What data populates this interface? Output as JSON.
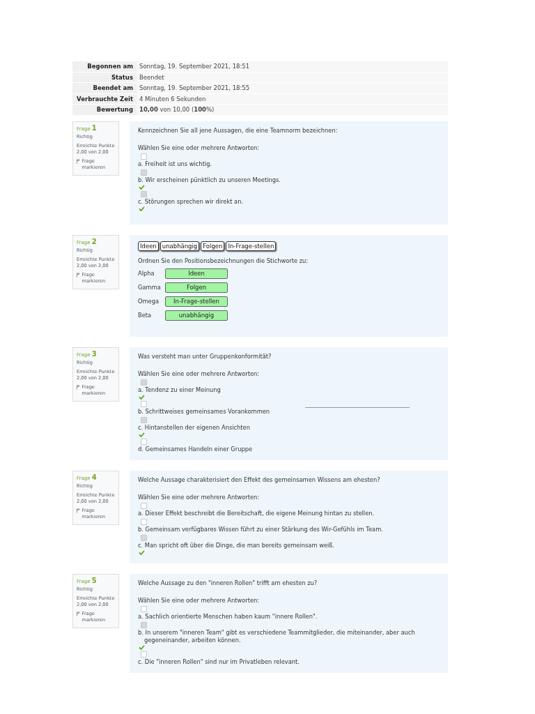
{
  "summary": [
    {
      "label": "Begonnen am",
      "value": "Sonntag, 19. September 2021, 18:51"
    },
    {
      "label": "Status",
      "value": "Beendet"
    },
    {
      "label": "Beendet am",
      "value": "Sonntag, 19. September 2021, 18:55"
    },
    {
      "label": "Verbrauchte Zeit",
      "value": "4 Minuten 6 Sekunden"
    },
    {
      "label": "Bewertung",
      "value": "**10,00** von 10,00 (**100**%)"
    }
  ],
  "questions": [
    {
      "kind": "multiple",
      "frage": "Frage",
      "number": "1",
      "state": "Richtig",
      "points_label": "Erreichte Punkte",
      "points": "2,00 von 2,00",
      "flag": "Frage markieren",
      "text": "Kennzeichnen Sie all jene Aussagen, die eine Teamnorm bezeichnen:",
      "instruction": "Wählen Sie eine oder mehrere Antworten:",
      "options": [
        {
          "label": "a. Freiheit ist uns wichtig.",
          "checked": false,
          "correct": false
        },
        {
          "label": "b. Wir erscheinen pünktlich zu unseren Meetings.",
          "checked": true,
          "correct": true
        },
        {
          "label": "c. Störungen sprechen wir direkt an.",
          "checked": true,
          "correct": true
        }
      ]
    },
    {
      "kind": "match",
      "frage": "Frage",
      "number": "2",
      "state": "Richtig",
      "points_label": "Erreichte Punkte",
      "points": "2,00 von 2,00",
      "flag": "Frage markieren",
      "tokens": [
        "Ideen",
        "unabhängig",
        "Folgen",
        "In-Frage-stellen"
      ],
      "text": "Ordnen Sie den Positionsbezeichnungen die Stichworte zu:",
      "pairs": [
        {
          "label": "Alpha",
          "answer": "Ideen"
        },
        {
          "label": "Gamma",
          "answer": "Folgen"
        },
        {
          "label": "Omega",
          "answer": "In-Frage-stellen"
        },
        {
          "label": "Beta",
          "answer": "unabhängig"
        }
      ]
    },
    {
      "kind": "multiple",
      "frage": "Frage",
      "number": "3",
      "state": "Richtig",
      "points_label": "Erreichte Punkte",
      "points": "2,00 von 2,00",
      "flag": "Frage markieren",
      "text": "Was versteht man unter Gruppenkonformität?",
      "instruction": "Wählen Sie eine oder mehrere Antworten:",
      "options": [
        {
          "label": "a. Tendenz zu einer Meinung",
          "checked": true,
          "correct": true
        },
        {
          "label": "b. Schrittweises gemeinsames Vorankommen",
          "checked": false,
          "correct": false
        },
        {
          "label": "c. Hintanstellen der eigenen Ansichten",
          "checked": true,
          "correct": true
        },
        {
          "label": "d. Gemeinsames Handeln einer Gruppe",
          "checked": false,
          "correct": false
        }
      ]
    },
    {
      "kind": "multiple",
      "frage": "Frage",
      "number": "4",
      "state": "Richtig",
      "points_label": "Erreichte Punkte",
      "points": "2,00 von 2,00",
      "flag": "Frage markieren",
      "text": "Welche Aussage charakterisiert den Effekt des gemeinsamen Wissens am ehesten?",
      "instruction": "Wählen Sie eine oder mehrere Antworten:",
      "options": [
        {
          "label": "a. Dieser Effekt beschreibt die Bereitschaft, die eigene Meinung hintan zu stellen.",
          "checked": false,
          "correct": false
        },
        {
          "label": "b. Gemeinsam verfügbares Wissen führt zu einer Stärkung des Wir-Gefühls im Team.",
          "checked": false,
          "correct": false
        },
        {
          "label": "c. Man spricht oft über die Dinge, die man bereits gemeinsam weiß.",
          "checked": true,
          "correct": true
        }
      ]
    },
    {
      "kind": "multiple",
      "frage": "Frage",
      "number": "5",
      "state": "Richtig",
      "points_label": "Erreichte Punkte",
      "points": "2,00 von 2,00",
      "flag": "Frage markieren",
      "text": "Welche Aussage zu den \"inneren Rollen\" trifft am ehesten zu?",
      "instruction": "Wählen Sie eine oder mehrere Antworten:",
      "options": [
        {
          "label": "a. Sachlich orientierte Menschen haben kaum \"innere Rollen\".",
          "checked": false,
          "correct": false
        },
        {
          "label": "b. In unserem \"inneren Team\" gibt es verschiedene Teammitglieder, die miteinander, aber auch gegeneinander, arbeiten können.",
          "checked": true,
          "correct": true
        },
        {
          "label": "c. Die \"inneren Rollen\" sind nur im Privatleben relevant.",
          "checked": false,
          "correct": false
        }
      ]
    }
  ]
}
